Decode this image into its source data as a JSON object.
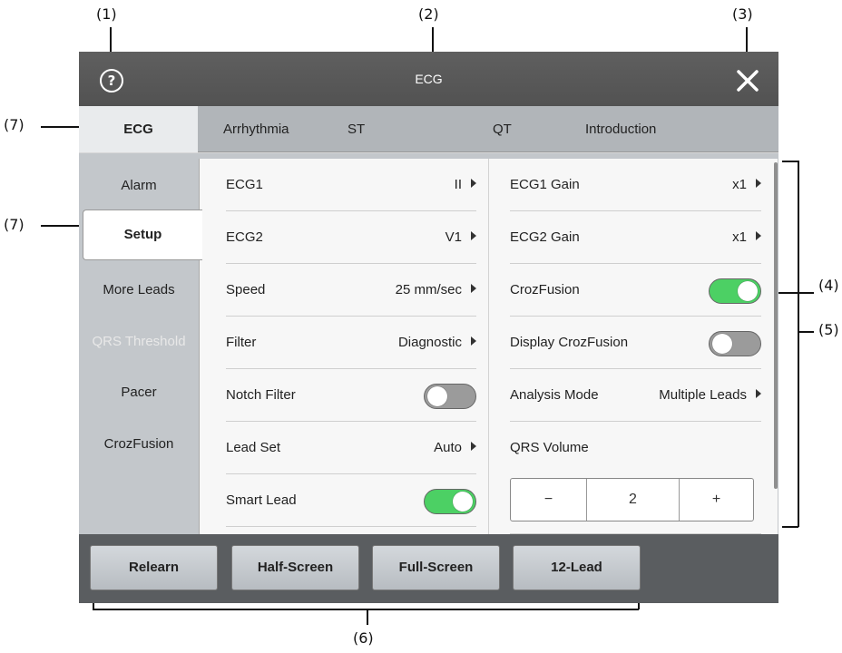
{
  "callouts": {
    "c1": "(1)",
    "c2": "(2)",
    "c3": "(3)",
    "c4": "(4)",
    "c5": "(5)",
    "c6": "(6)",
    "c7a": "(7)",
    "c7b": "(7)"
  },
  "titlebar": {
    "title": "ECG",
    "help_icon": "question-circle-icon",
    "close_icon": "close-x-icon"
  },
  "tabs": [
    "ECG",
    "Arrhythmia",
    "ST",
    "QT",
    "Introduction"
  ],
  "tabs_active": "ECG",
  "sidebar": {
    "items": [
      "Alarm",
      "Setup",
      "More Leads",
      "QRS Threshold",
      "Pacer",
      "CrozFusion"
    ],
    "active": "Setup",
    "disabled": [
      "QRS Threshold"
    ]
  },
  "left_column": [
    {
      "label": "ECG1",
      "value": "II"
    },
    {
      "label": "ECG2",
      "value": "V1"
    },
    {
      "label": "Speed",
      "value": "25 mm/sec"
    },
    {
      "label": "Filter",
      "value": "Diagnostic"
    },
    {
      "label": "Notch Filter",
      "toggle": "off"
    },
    {
      "label": "Lead Set",
      "value": "Auto"
    },
    {
      "label": "Smart Lead",
      "toggle": "on"
    }
  ],
  "right_column": [
    {
      "label": "ECG1 Gain",
      "value": "x1"
    },
    {
      "label": "ECG2 Gain",
      "value": "x1"
    },
    {
      "label": "CrozFusion",
      "toggle": "on"
    },
    {
      "label": "Display CrozFusion",
      "toggle": "off"
    },
    {
      "label": "Analysis Mode",
      "value": "Multiple Leads"
    },
    {
      "label": "QRS Volume"
    }
  ],
  "qrs_volume": {
    "minus": "−",
    "value": "2",
    "plus": "+"
  },
  "bottom_buttons": [
    "Relearn",
    "Half-Screen",
    "Full-Screen",
    "12-Lead"
  ],
  "colors": {
    "toggle_on": "#4cd064",
    "toggle_off": "#9b9b9b",
    "titlebar": "#585858",
    "tabbar": "#b1b5b9"
  }
}
